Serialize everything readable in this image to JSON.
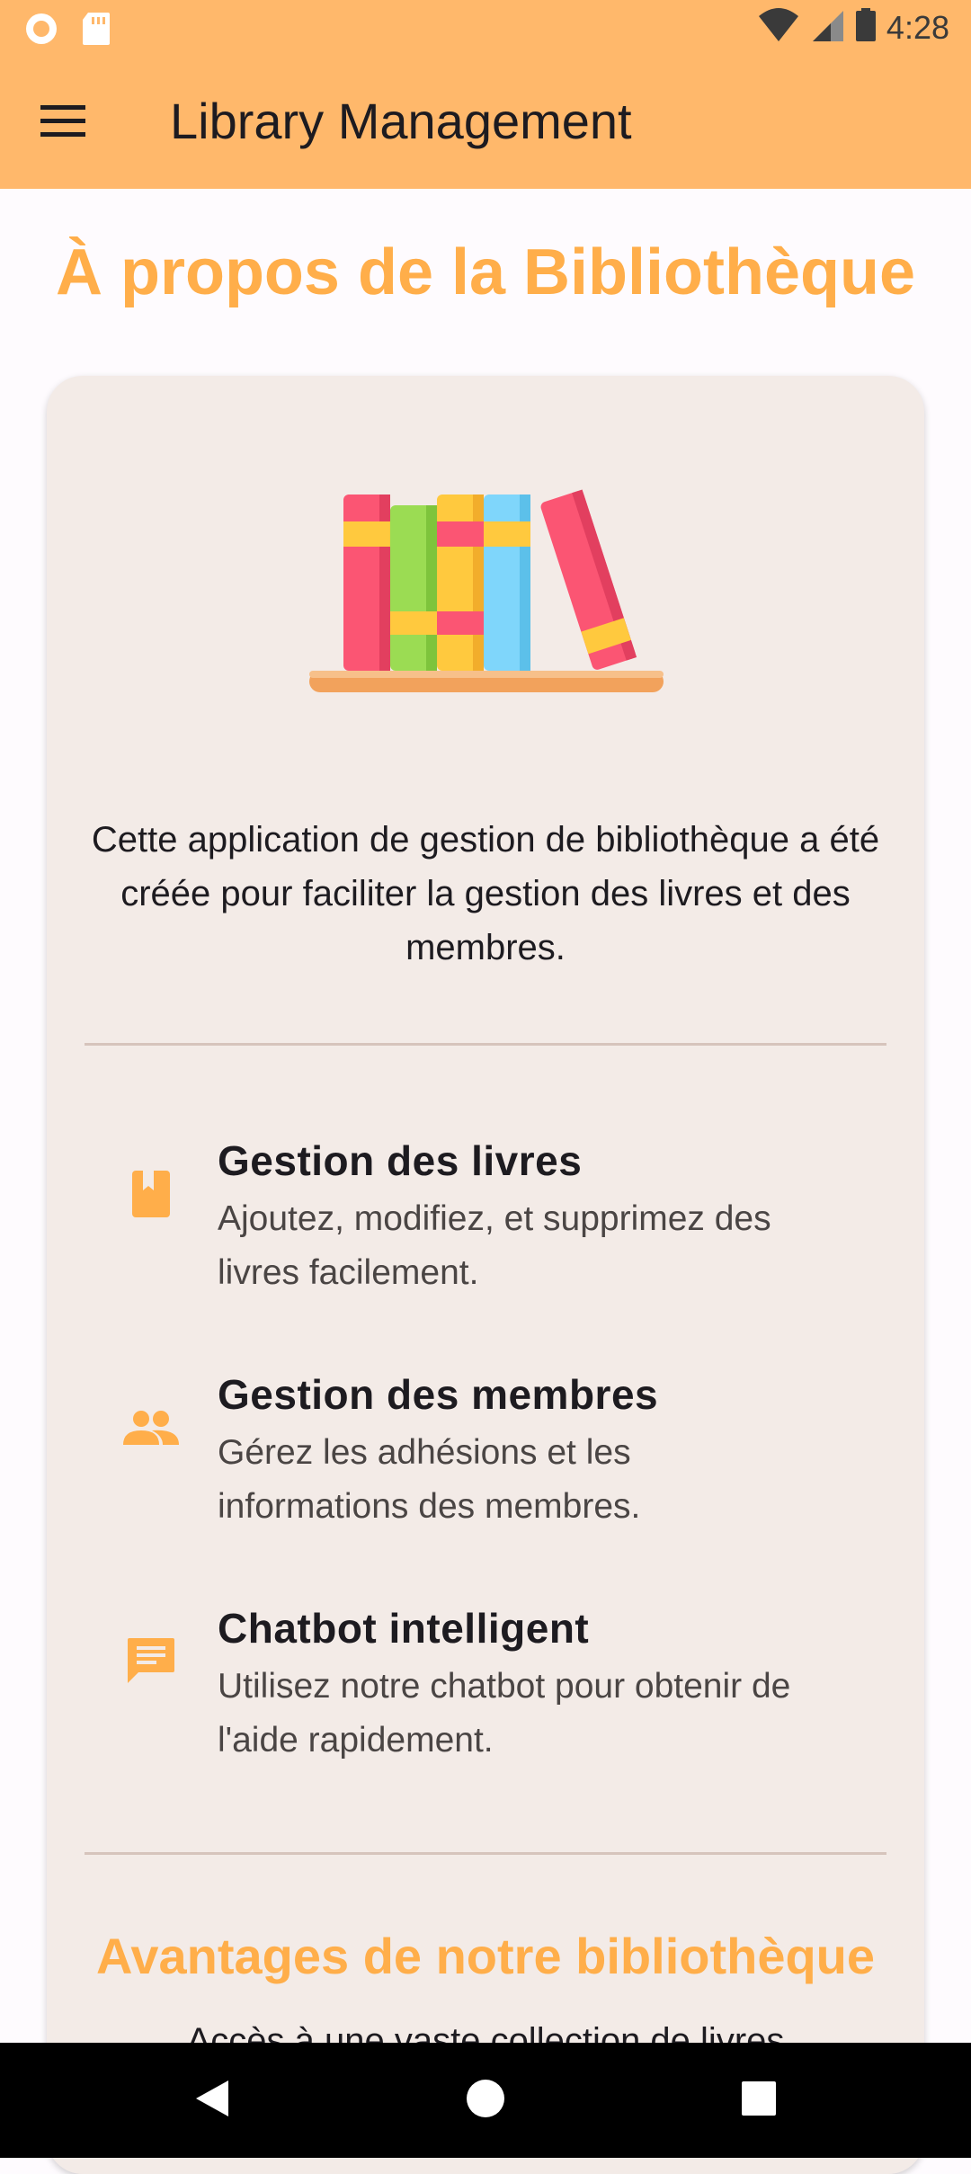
{
  "status_bar": {
    "time": "4:28",
    "icons": [
      "record-icon",
      "sd-card-icon",
      "wifi-icon",
      "signal-icon",
      "battery-icon"
    ]
  },
  "app_bar": {
    "title": "Library Management",
    "menu_icon": "menu-icon"
  },
  "page": {
    "title": "À propos de la Bibliothèque"
  },
  "card": {
    "illustration": "books-on-shelf-illustration",
    "intro": "Cette application de gestion de bibliothèque a été créée pour faciliter la gestion des livres et des membres.",
    "features": [
      {
        "icon": "book-icon",
        "title": "Gestion des livres",
        "description": "Ajoutez, modifiez, et supprimez des livres facilement."
      },
      {
        "icon": "people-icon",
        "title": "Gestion des membres",
        "description": "Gérez les adhésions et les informations des membres."
      },
      {
        "icon": "chat-icon",
        "title": "Chatbot intelligent",
        "description": "Utilisez notre chatbot pour obtenir de l'aide rapidement."
      }
    ],
    "advantages_title": "Avantages de notre bibliothèque",
    "advantages_first_line": "Accès à une vaste collection de livres"
  },
  "colors": {
    "accent": "#ffae4a",
    "app_bar": "#ffb86b",
    "card": "#f3ebe7"
  }
}
